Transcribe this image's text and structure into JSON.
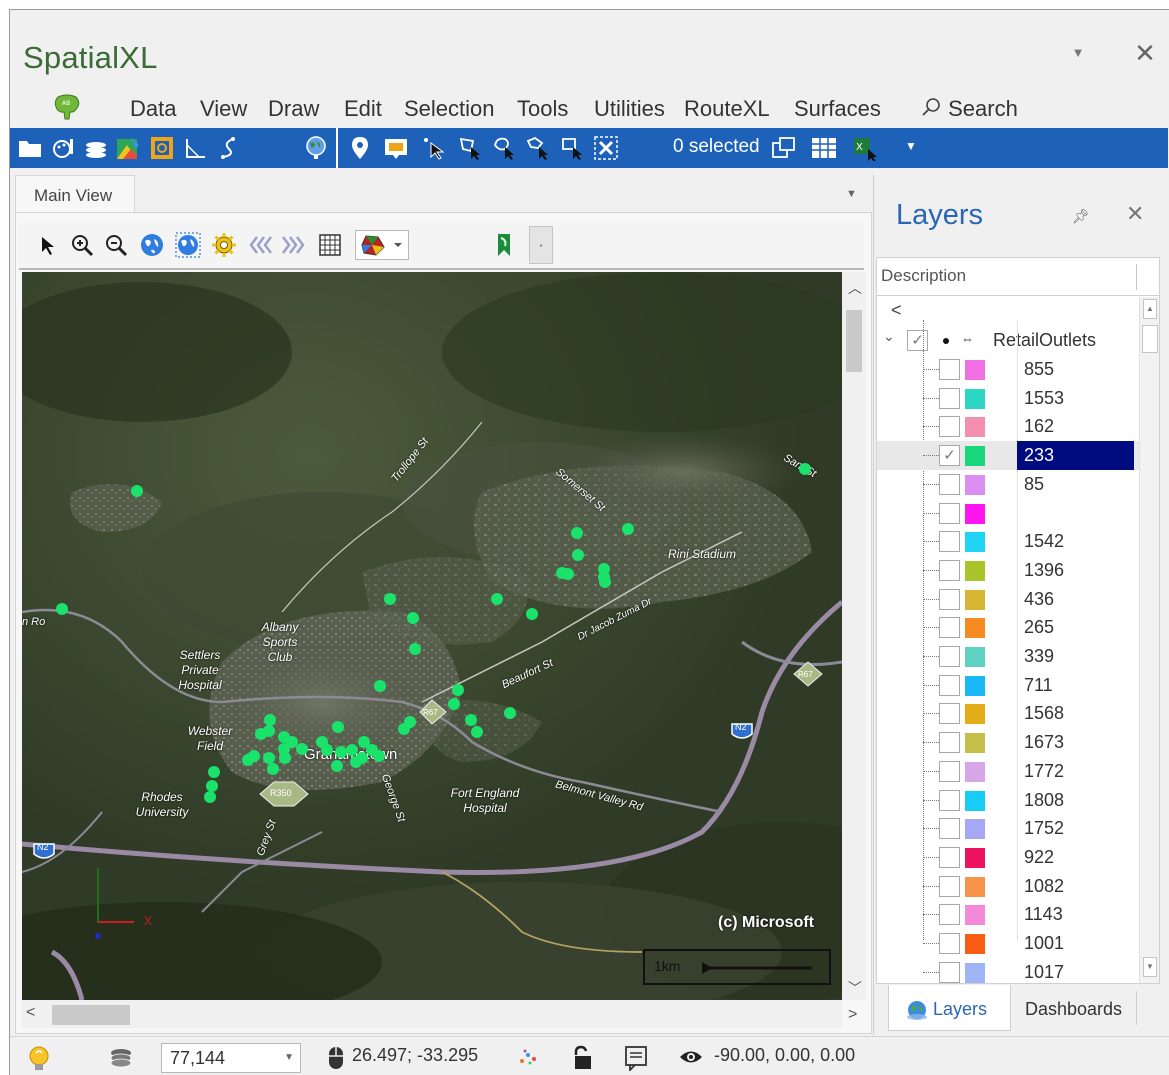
{
  "app": {
    "title": "SpatialXL"
  },
  "menu": {
    "items": [
      "Data",
      "View",
      "Draw",
      "Edit",
      "Selection",
      "Tools",
      "Utilities",
      "RouteXL",
      "Surfaces"
    ],
    "active": "Tools",
    "search_label": "Search"
  },
  "ribbon": {
    "selected_count": "0 selected"
  },
  "main_view": {
    "tab_label": "Main View"
  },
  "map": {
    "labels": {
      "trollope": "Trollope St",
      "somerset": "Somerset St",
      "rini": "Rini Stadium",
      "dr_jacob": "Dr Jacob Zuma Dr",
      "albany": "Albany Sports Club",
      "settlers": "Settlers Private Hospital",
      "webster": "Webster Field",
      "grahamstown": "Grahamstown",
      "rhodes": "Rhodes University",
      "fort_england": "Fort England Hospital",
      "belmont": "Belmont Valley Rd",
      "beaufort": "Beaufort St",
      "george": "George St",
      "grey": "Grey St",
      "road_r67a": "R67",
      "road_r67b": "R67",
      "road_n2a": "N2",
      "road_n2b": "N2",
      "road_r350": "R350",
      "copyright": "(c) Microsoft",
      "scale": "1km",
      "axis_x": "X",
      "sani": "Sani St",
      "partial_left": "n Ro"
    }
  },
  "layers_panel": {
    "title": "Layers",
    "description_header": "Description",
    "back_arrow": "<",
    "root_layer": "RetailOutlets",
    "items": [
      {
        "label": "855",
        "color": "#f06fe3",
        "checked": false,
        "selected": false
      },
      {
        "label": "1553",
        "color": "#2bd6c4",
        "checked": false,
        "selected": false
      },
      {
        "label": "162",
        "color": "#f58fb0",
        "checked": false,
        "selected": false
      },
      {
        "label": "233",
        "color": "#19d67c",
        "checked": true,
        "selected": true
      },
      {
        "label": "85",
        "color": "#d98ef0",
        "checked": false,
        "selected": false
      },
      {
        "label": "",
        "color": "#ff15f0",
        "checked": false,
        "selected": false
      },
      {
        "label": "1542",
        "color": "#1fd4f5",
        "checked": false,
        "selected": false
      },
      {
        "label": "1396",
        "color": "#a8c42a",
        "checked": false,
        "selected": false
      },
      {
        "label": "436",
        "color": "#d8b435",
        "checked": false,
        "selected": false
      },
      {
        "label": "265",
        "color": "#f48c22",
        "checked": false,
        "selected": false
      },
      {
        "label": "339",
        "color": "#5fd1c0",
        "checked": false,
        "selected": false
      },
      {
        "label": "711",
        "color": "#1ab8f5",
        "checked": false,
        "selected": false
      },
      {
        "label": "1568",
        "color": "#e2ad16",
        "checked": false,
        "selected": false
      },
      {
        "label": "1673",
        "color": "#c4c04a",
        "checked": false,
        "selected": false
      },
      {
        "label": "1772",
        "color": "#d6a6e6",
        "checked": false,
        "selected": false
      },
      {
        "label": "1808",
        "color": "#17cdf7",
        "checked": false,
        "selected": false
      },
      {
        "label": "1752",
        "color": "#a6a8f5",
        "checked": false,
        "selected": false
      },
      {
        "label": "922",
        "color": "#ee1361",
        "checked": false,
        "selected": false
      },
      {
        "label": "1082",
        "color": "#f7934a",
        "checked": false,
        "selected": false
      },
      {
        "label": "1143",
        "color": "#f28ad8",
        "checked": false,
        "selected": false
      },
      {
        "label": "1001",
        "color": "#f75d14",
        "checked": false,
        "selected": false
      },
      {
        "label": "1017",
        "color": "#9fb4f5",
        "checked": false,
        "selected": false
      }
    ],
    "tabs": {
      "layers": "Layers",
      "dashboards": "Dashboards"
    }
  },
  "status_bar": {
    "zoom_value": "77,144",
    "coordinates": "26.497; -33.295",
    "view_params": "-90.00, 0.00, 0.00"
  },
  "colors": {
    "accent": "#1d62b8",
    "title_green": "#3a6b35",
    "point_green": "#19e36a",
    "selected_row": "#000b80"
  }
}
